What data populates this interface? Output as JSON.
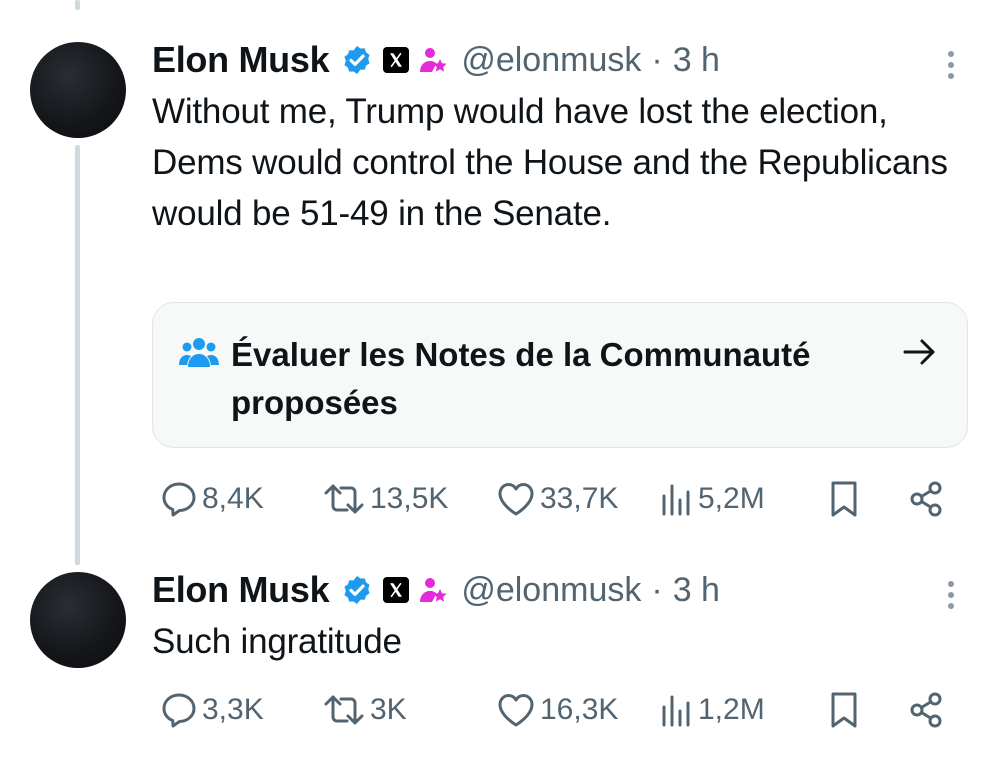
{
  "tweets": [
    {
      "author": "Elon Musk",
      "handle": "@elonmusk",
      "separator": "·",
      "time": "3 h",
      "text": "Without me, Trump would have lost the election, Dems would control the House and the Republicans would be 51-49 in the Senate.",
      "community_note": {
        "label": "Évaluer les Notes de la Communauté proposées"
      },
      "stats": {
        "replies": "8,4K",
        "reposts": "13,5K",
        "likes": "33,7K",
        "views": "5,2M"
      }
    },
    {
      "author": "Elon Musk",
      "handle": "@elonmusk",
      "separator": "·",
      "time": "3 h",
      "text": "Such ingratitude",
      "stats": {
        "replies": "3,3K",
        "reposts": "3K",
        "likes": "16,3K",
        "views": "1,2M"
      }
    }
  ],
  "icons": {
    "verified": "verified-badge-icon",
    "affiliate": "x-affiliate-badge-icon",
    "role": "subscriber-role-icon",
    "more": "more-vertical-icon",
    "community_notes": "community-notes-icon",
    "arrow": "arrow-right-icon",
    "reply": "reply-icon",
    "repost": "repost-icon",
    "like": "like-icon",
    "views": "views-icon",
    "bookmark": "bookmark-icon",
    "share": "share-icon"
  },
  "colors": {
    "verified": "#1d9bf0",
    "role": "#e52bd9",
    "secondary_text": "#536471",
    "text": "#0f1419"
  }
}
